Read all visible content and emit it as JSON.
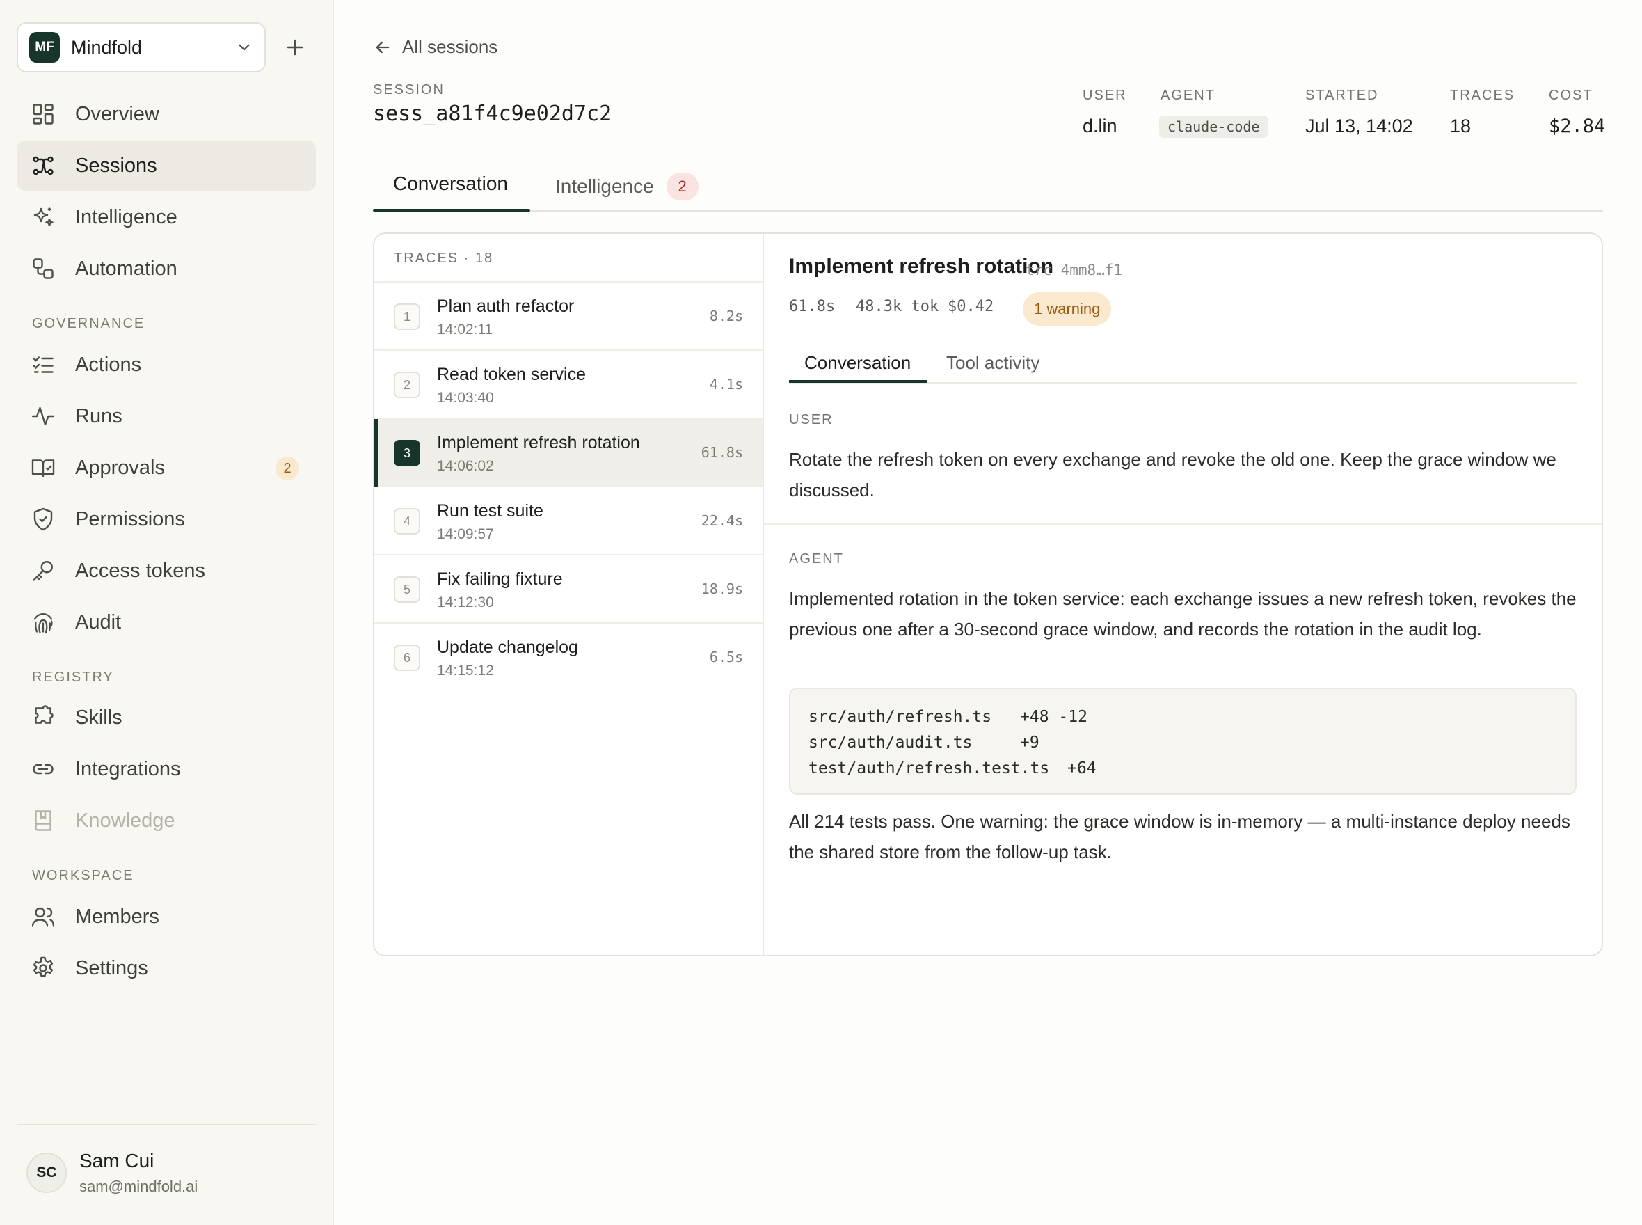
{
  "workspace": {
    "initials": "MF",
    "name": "Mindfold"
  },
  "nav": {
    "main": [
      {
        "label": "Overview",
        "icon": "overview-icon"
      },
      {
        "label": "Sessions",
        "icon": "sessions-icon"
      },
      {
        "label": "Intelligence",
        "icon": "sparkle-icon"
      },
      {
        "label": "Automation",
        "icon": "automation-icon"
      }
    ],
    "governance_label": "GOVERNANCE",
    "governance": [
      {
        "label": "Actions",
        "icon": "checklist-icon"
      },
      {
        "label": "Runs",
        "icon": "activity-icon"
      },
      {
        "label": "Approvals",
        "icon": "approvals-icon",
        "badge": "2"
      },
      {
        "label": "Permissions",
        "icon": "shield-icon"
      },
      {
        "label": "Access tokens",
        "icon": "key-icon"
      },
      {
        "label": "Audit",
        "icon": "fingerprint-icon"
      }
    ],
    "registry_label": "REGISTRY",
    "registry": [
      {
        "label": "Skills",
        "icon": "puzzle-icon"
      },
      {
        "label": "Integrations",
        "icon": "link-icon"
      },
      {
        "label": "Knowledge",
        "icon": "book-icon"
      }
    ],
    "workspace_label": "WORKSPACE",
    "workspace": [
      {
        "label": "Members",
        "icon": "users-icon"
      },
      {
        "label": "Settings",
        "icon": "gear-icon"
      }
    ]
  },
  "user": {
    "initials": "SC",
    "name": "Sam Cui",
    "email": "sam@mindfold.ai"
  },
  "back_label": "All sessions",
  "session": {
    "label": "SESSION",
    "id": "sess_a81f4c9e02d7c2",
    "meta": {
      "user_label": "USER",
      "user": "d.lin",
      "agent_label": "AGENT",
      "agent": "claude-code",
      "started_label": "STARTED",
      "started": "Jul 13, 14:02",
      "traces_label": "TRACES",
      "traces": "18",
      "cost_label": "COST",
      "cost": "$2.84"
    }
  },
  "tabs": {
    "conversation": "Conversation",
    "intelligence": "Intelligence",
    "intelligence_badge": "2"
  },
  "traces": {
    "header": "TRACES · 18",
    "items": [
      {
        "num": "1",
        "title": "Plan auth refactor",
        "time": "14:02:11",
        "duration": "8.2s"
      },
      {
        "num": "2",
        "title": "Read token service",
        "time": "14:03:40",
        "duration": "4.1s"
      },
      {
        "num": "3",
        "title": "Implement refresh rotation",
        "time": "14:06:02",
        "duration": "61.8s"
      },
      {
        "num": "4",
        "title": "Run test suite",
        "time": "14:09:57",
        "duration": "22.4s"
      },
      {
        "num": "5",
        "title": "Fix failing fixture",
        "time": "14:12:30",
        "duration": "18.9s"
      },
      {
        "num": "6",
        "title": "Update changelog",
        "time": "14:15:12",
        "duration": "6.5s"
      }
    ]
  },
  "detail": {
    "title": "Implement refresh rotation",
    "trace_id": "trc_4mm8…f1",
    "duration": "61.8s",
    "tokens": "48.3k tok",
    "cost": "$0.42",
    "warning": "1 warning",
    "sub_tabs": {
      "conversation": "Conversation",
      "tool_activity": "Tool activity"
    },
    "user_label": "USER",
    "user_message": "Rotate the refresh token on every exchange and revoke the old one. Keep the grace window we discussed.",
    "agent_label": "AGENT",
    "agent_message": "Implemented rotation in the token service: each exchange issues a new refresh token, revokes the previous one after a 30-second grace window, and records the rotation in the audit log.",
    "files": [
      {
        "path": "src/auth/refresh.ts",
        "diff": "+48 -12"
      },
      {
        "path": "src/auth/audit.ts",
        "diff": "+9"
      },
      {
        "path": "test/auth/refresh.test.ts",
        "diff": "+64"
      }
    ],
    "agent_summary": "All 214 tests pass. One warning: the grace window is in-memory — a multi-instance deploy needs the shared store from the follow-up task."
  },
  "colors": {
    "brand": "#17352a",
    "warning_bg": "#fbe9cf",
    "warning_fg": "#9a5b10",
    "badge_red_bg": "#fbe3e1",
    "badge_red_fg": "#b3261e"
  }
}
